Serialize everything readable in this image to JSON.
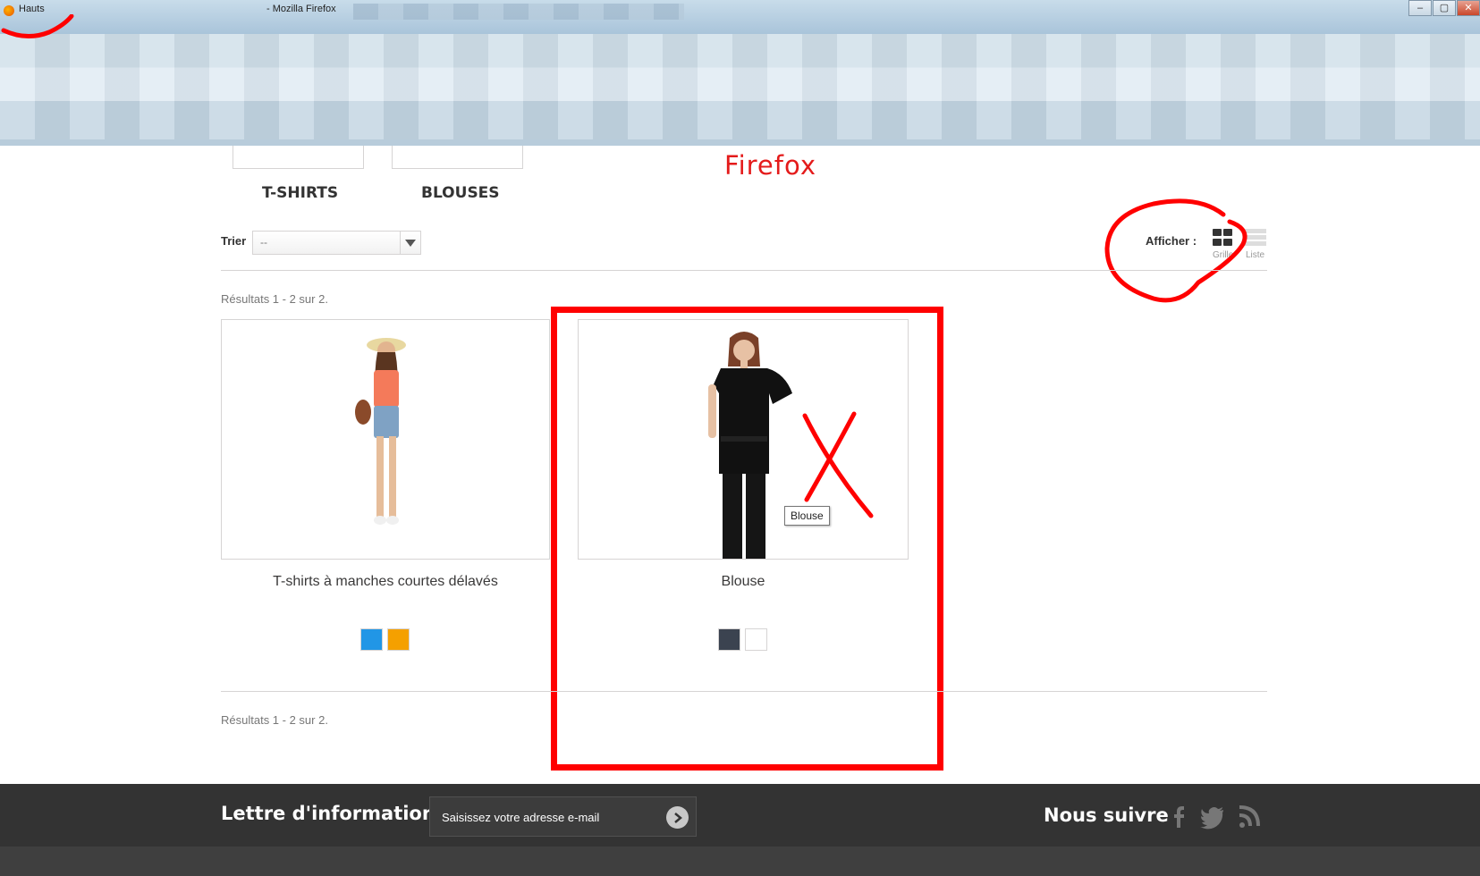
{
  "window": {
    "tab_title": "Hauts",
    "app_title": "- Mozilla Firefox",
    "buttons": [
      "–",
      "▢",
      "✕"
    ]
  },
  "annotations": {
    "firefox_label": "Firefox",
    "mark_color": "#ff0000"
  },
  "subcategories": [
    {
      "label": "T-SHIRTS"
    },
    {
      "label": "BLOUSES"
    }
  ],
  "sort": {
    "label": "Trier",
    "selected": "--"
  },
  "view": {
    "label": "Afficher :",
    "grid_label": "Grille",
    "list_label": "Liste",
    "active": "grid"
  },
  "results_text": "Résultats 1 - 2 sur 2.",
  "products": [
    {
      "name": "T-shirts à manches courtes délavés",
      "colors": [
        "#2196e6",
        "#f5a000"
      ]
    },
    {
      "name": "Blouse",
      "tooltip": "Blouse",
      "colors": [
        "#3b4350",
        "#ffffff"
      ]
    }
  ],
  "footer": {
    "newsletter_title": "Lettre d'informations",
    "newsletter_placeholder": "Saisissez votre adresse e-mail",
    "follow_title": "Nous suivre",
    "social_icons": [
      "facebook-icon",
      "twitter-icon",
      "rss-icon"
    ]
  }
}
